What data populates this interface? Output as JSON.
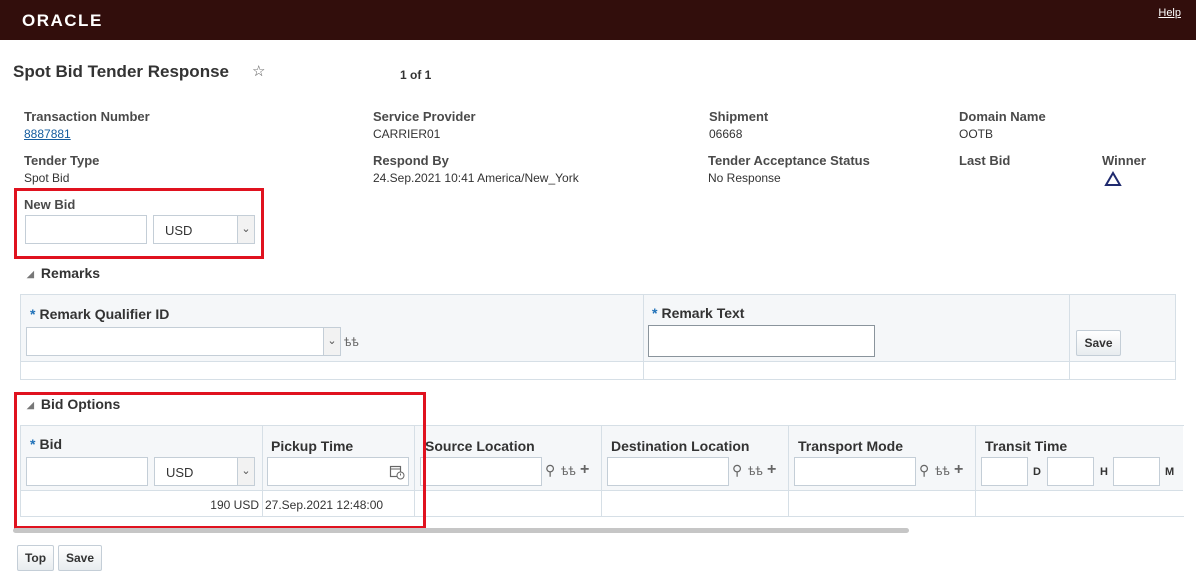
{
  "brand": "ORACLE",
  "help_label": "Help",
  "page_title": "Spot Bid Tender Response",
  "star_icon": "☆",
  "pager": "1 of 1",
  "header": {
    "transaction_number": {
      "label": "Transaction Number",
      "value": "8887881"
    },
    "service_provider": {
      "label": "Service Provider",
      "value": "CARRIER01"
    },
    "shipment": {
      "label": "Shipment",
      "value": "06668"
    },
    "domain_name": {
      "label": "Domain Name",
      "value": "OOTB"
    },
    "tender_type": {
      "label": "Tender Type",
      "value": "Spot Bid"
    },
    "respond_by": {
      "label": "Respond By",
      "value": "24.Sep.2021 10:41 America/New_York"
    },
    "tender_acceptance_status": {
      "label": "Tender Acceptance Status",
      "value": "No Response"
    },
    "last_bid": {
      "label": "Last Bid",
      "value": ""
    },
    "winner": {
      "label": "Winner",
      "icon": "triangle-icon"
    }
  },
  "new_bid": {
    "label": "New Bid",
    "value": "",
    "currency": "USD"
  },
  "remarks": {
    "title": "Remarks",
    "qualifier_label": "Remark Qualifier ID",
    "qualifier_value": "",
    "text_label": "Remark Text",
    "text_value": "",
    "save_label": "Save"
  },
  "bid_options": {
    "title": "Bid Options",
    "columns": {
      "bid": "Bid",
      "pickup_time": "Pickup Time",
      "source_location": "Source Location",
      "destination_location": "Destination Location",
      "transport_mode": "Transport Mode",
      "transit_time": "Transit Time"
    },
    "bid_currency": "USD",
    "transit_units": {
      "d": "D",
      "h": "H",
      "m": "M"
    },
    "rows": [
      {
        "bid": "190 USD",
        "pickup_time": "27.Sep.2021 12:48:00"
      }
    ]
  },
  "footer": {
    "top_label": "Top",
    "save_label": "Save"
  },
  "colors": {
    "header_bg": "#320e0c",
    "highlight": "#e0121f",
    "link": "#145c9e"
  }
}
